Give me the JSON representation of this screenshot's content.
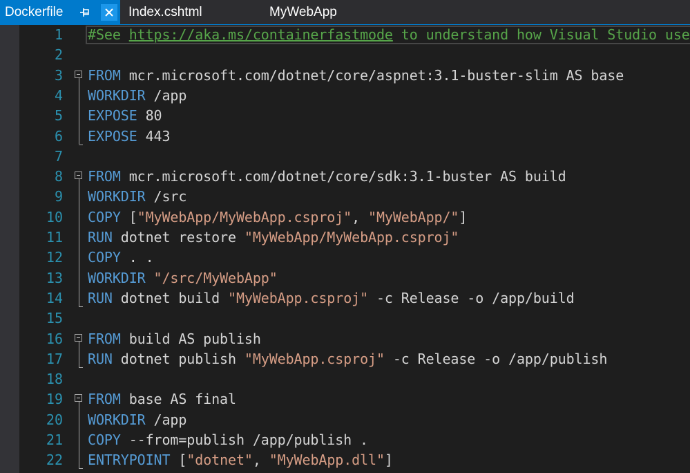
{
  "tabs": {
    "active": {
      "label": "Dockerfile"
    },
    "second": {
      "label": "Index.cshtml"
    },
    "third": {
      "label": "MyWebApp"
    }
  },
  "icons": {
    "pin": "pin-icon",
    "close": "close-icon"
  },
  "colors": {
    "accent": "#007acc",
    "keyword": "#569cd6",
    "string": "#d69d85",
    "comment": "#57a64a",
    "line_number": "#2b91af",
    "text": "#d4d4d4",
    "background": "#1e1e1e"
  },
  "code": {
    "lines": [
      {
        "n": "1",
        "tokens": [
          {
            "t": "cmt",
            "v": "#See "
          },
          {
            "t": "link",
            "v": "https://aka.ms/containerfastmode"
          },
          {
            "t": "cmt",
            "v": " to understand how Visual Studio uses"
          }
        ]
      },
      {
        "n": "2",
        "tokens": []
      },
      {
        "n": "3",
        "tokens": [
          {
            "t": "kw",
            "v": "FROM"
          },
          {
            "t": "txt",
            "v": " mcr.microsoft.com/dotnet/core/aspnet:3.1-buster-slim AS base"
          }
        ]
      },
      {
        "n": "4",
        "tokens": [
          {
            "t": "kw",
            "v": "WORKDIR"
          },
          {
            "t": "txt",
            "v": " /app"
          }
        ]
      },
      {
        "n": "5",
        "tokens": [
          {
            "t": "kw",
            "v": "EXPOSE"
          },
          {
            "t": "txt",
            "v": " 80"
          }
        ]
      },
      {
        "n": "6",
        "tokens": [
          {
            "t": "kw",
            "v": "EXPOSE"
          },
          {
            "t": "txt",
            "v": " 443"
          }
        ]
      },
      {
        "n": "7",
        "tokens": []
      },
      {
        "n": "8",
        "tokens": [
          {
            "t": "kw",
            "v": "FROM"
          },
          {
            "t": "txt",
            "v": " mcr.microsoft.com/dotnet/core/sdk:3.1-buster AS build"
          }
        ]
      },
      {
        "n": "9",
        "tokens": [
          {
            "t": "kw",
            "v": "WORKDIR"
          },
          {
            "t": "txt",
            "v": " /src"
          }
        ]
      },
      {
        "n": "10",
        "tokens": [
          {
            "t": "kw",
            "v": "COPY"
          },
          {
            "t": "txt",
            "v": " ["
          },
          {
            "t": "str",
            "v": "\"MyWebApp/MyWebApp.csproj\""
          },
          {
            "t": "txt",
            "v": ", "
          },
          {
            "t": "str",
            "v": "\"MyWebApp/\""
          },
          {
            "t": "txt",
            "v": "]"
          }
        ]
      },
      {
        "n": "11",
        "tokens": [
          {
            "t": "kw",
            "v": "RUN"
          },
          {
            "t": "txt",
            "v": " dotnet restore "
          },
          {
            "t": "str",
            "v": "\"MyWebApp/MyWebApp.csproj\""
          }
        ]
      },
      {
        "n": "12",
        "tokens": [
          {
            "t": "kw",
            "v": "COPY"
          },
          {
            "t": "txt",
            "v": " . ."
          }
        ]
      },
      {
        "n": "13",
        "tokens": [
          {
            "t": "kw",
            "v": "WORKDIR"
          },
          {
            "t": "txt",
            "v": " "
          },
          {
            "t": "str",
            "v": "\"/src/MyWebApp\""
          }
        ]
      },
      {
        "n": "14",
        "tokens": [
          {
            "t": "kw",
            "v": "RUN"
          },
          {
            "t": "txt",
            "v": " dotnet build "
          },
          {
            "t": "str",
            "v": "\"MyWebApp.csproj\""
          },
          {
            "t": "txt",
            "v": " -c Release -o /app/build"
          }
        ]
      },
      {
        "n": "15",
        "tokens": []
      },
      {
        "n": "16",
        "tokens": [
          {
            "t": "kw",
            "v": "FROM"
          },
          {
            "t": "txt",
            "v": " build AS publish"
          }
        ]
      },
      {
        "n": "17",
        "tokens": [
          {
            "t": "kw",
            "v": "RUN"
          },
          {
            "t": "txt",
            "v": " dotnet publish "
          },
          {
            "t": "str",
            "v": "\"MyWebApp.csproj\""
          },
          {
            "t": "txt",
            "v": " -c Release -o /app/publish"
          }
        ]
      },
      {
        "n": "18",
        "tokens": []
      },
      {
        "n": "19",
        "tokens": [
          {
            "t": "kw",
            "v": "FROM"
          },
          {
            "t": "txt",
            "v": " base AS final"
          }
        ]
      },
      {
        "n": "20",
        "tokens": [
          {
            "t": "kw",
            "v": "WORKDIR"
          },
          {
            "t": "txt",
            "v": " /app"
          }
        ]
      },
      {
        "n": "21",
        "tokens": [
          {
            "t": "kw",
            "v": "COPY"
          },
          {
            "t": "txt",
            "v": " --from=publish /app/publish ."
          }
        ]
      },
      {
        "n": "22",
        "tokens": [
          {
            "t": "kw",
            "v": "ENTRYPOINT"
          },
          {
            "t": "txt",
            "v": " ["
          },
          {
            "t": "str",
            "v": "\"dotnet\""
          },
          {
            "t": "txt",
            "v": ", "
          },
          {
            "t": "str",
            "v": "\"MyWebApp.dll\""
          },
          {
            "t": "txt",
            "v": "]"
          }
        ]
      }
    ]
  }
}
